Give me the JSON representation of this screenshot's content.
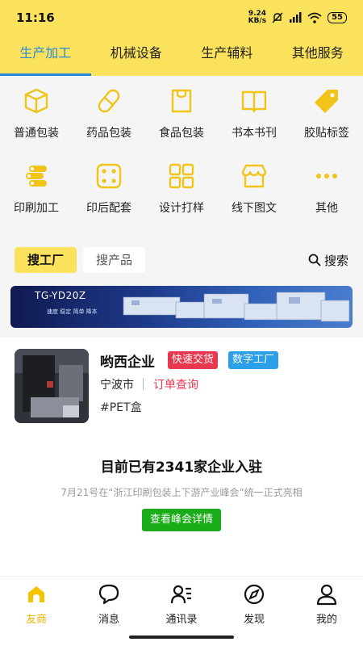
{
  "status": {
    "time": "11:16",
    "speed_value": "9.24",
    "speed_unit": "KB/s",
    "battery": "55"
  },
  "top_tabs": [
    "生产加工",
    "机械设备",
    "生产辅料",
    "其他服务"
  ],
  "categories": [
    {
      "label": "普通包装",
      "icon": "box-icon"
    },
    {
      "label": "药品包装",
      "icon": "pill-icon"
    },
    {
      "label": "食品包装",
      "icon": "food-bag-icon"
    },
    {
      "label": "书本书刊",
      "icon": "book-icon"
    },
    {
      "label": "胶贴标签",
      "icon": "tag-icon"
    },
    {
      "label": "印刷加工",
      "icon": "print-roll-icon"
    },
    {
      "label": "印后配套",
      "icon": "dice-icon"
    },
    {
      "label": "设计打样",
      "icon": "grid-icon"
    },
    {
      "label": "线下图文",
      "icon": "shop-icon"
    },
    {
      "label": "其他",
      "icon": "more-icon"
    }
  ],
  "search": {
    "factory_tab": "搜工厂",
    "product_tab": "搜产品",
    "search_label": "搜索"
  },
  "banner": {
    "title": "TG-YD20Z",
    "subtitle": "速度 稳定 简单 降本"
  },
  "company": {
    "name": "哟西企业",
    "tags": [
      "快速交货",
      "数字工厂"
    ],
    "city": "宁波市",
    "order_link": "订单查询",
    "keyword": "#PET盒"
  },
  "summary": {
    "count_text": "目前已有2341家企业入驻",
    "notice": "7月21号在“浙江印刷包装上下游产业峰会”统一正式亮相",
    "button": "查看峰会详情"
  },
  "bottom_nav": [
    "友商",
    "消息",
    "通讯录",
    "发现",
    "我的"
  ],
  "colors": {
    "brand_yellow": "#fbe25c",
    "active_blue": "#2b88d8",
    "tag_red": "#e8384f",
    "tag_blue": "#2b9fe8",
    "cta_green": "#1aad19",
    "icon_gold": "#f0c419"
  }
}
